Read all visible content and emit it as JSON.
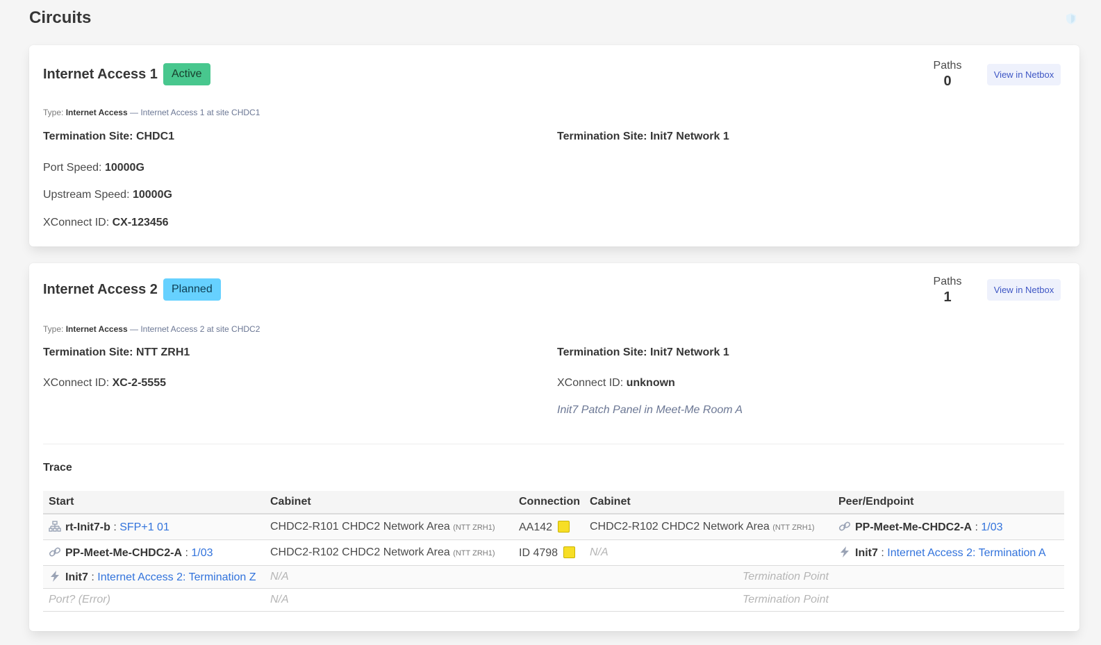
{
  "page": {
    "title": "Circuits",
    "shield_icon": "shield-icon"
  },
  "colors": {
    "active": "#48c78e",
    "planned": "#66d1ff",
    "link": "#3273dc",
    "cable_yellow": "#f7de26"
  },
  "circuits": [
    {
      "title": "Internet Access 1",
      "status": "Active",
      "paths_label": "Paths",
      "paths_value": "0",
      "button": "View in Netbox",
      "type_label": "Type:",
      "type_value": "Internet Access",
      "description": "— Internet Access 1 at site CHDC1",
      "term_a": "Termination Site: CHDC1",
      "term_z": "Termination Site: Init7 Network 1",
      "port_speed_label": "Port Speed:",
      "port_speed": "10000G",
      "upstream_label": "Upstream Speed:",
      "upstream": "10000G",
      "xconnect_label": "XConnect ID:",
      "xconnect": "CX-123456"
    },
    {
      "title": "Internet Access 2",
      "status": "Planned",
      "paths_label": "Paths",
      "paths_value": "1",
      "button": "View in Netbox",
      "type_label": "Type:",
      "type_value": "Internet Access",
      "description": "— Internet Access 2 at site CHDC2",
      "term_a": "Termination Site: NTT ZRH1",
      "term_z": "Termination Site: Init7 Network 1",
      "xconnect_label": "XConnect ID:",
      "xconnect_a": "XC-2-5555",
      "xconnect_z": "unknown",
      "note_z": "Init7 Patch Panel in Meet-Me Room A",
      "trace": {
        "title": "Trace",
        "headers": [
          "Start",
          "Cabinet",
          "Connection",
          "Cabinet",
          "Peer/Endpoint"
        ],
        "rows": [
          {
            "start_icon": "network-icon",
            "start_name": "rt-Init7-b",
            "sep": ":",
            "start_port": "SFP+1 01",
            "cab1": "CHDC2-R101 CHDC2 Network Area",
            "cab1_site": "(NTT ZRH1)",
            "conn": "AA142",
            "cab2": "CHDC2-R102 CHDC2 Network Area",
            "cab2_site": "(NTT ZRH1)",
            "end_icon": "link-icon",
            "end_name": "PP-Meet-Me-CHDC2-A",
            "end_port": "1/03"
          },
          {
            "start_icon": "link-icon",
            "start_name": "PP-Meet-Me-CHDC2-A",
            "sep": ":",
            "start_port": "1/03",
            "cab1": "CHDC2-R102 CHDC2 Network Area",
            "cab1_site": "(NTT ZRH1)",
            "conn": "ID 4798",
            "cab2": "N/A",
            "end_icon": "bolt-icon",
            "end_name": "Init7",
            "end_port": "Internet Access 2: Termination A"
          },
          {
            "start_icon": "bolt-icon",
            "start_name": "Init7",
            "sep": ":",
            "start_port": "Internet Access 2: Termination Z",
            "cab1": "N/A",
            "term": "Termination Point"
          },
          {
            "start_text": "Port? (Error)",
            "cab1": "N/A",
            "term": "Termination Point"
          }
        ]
      }
    }
  ]
}
